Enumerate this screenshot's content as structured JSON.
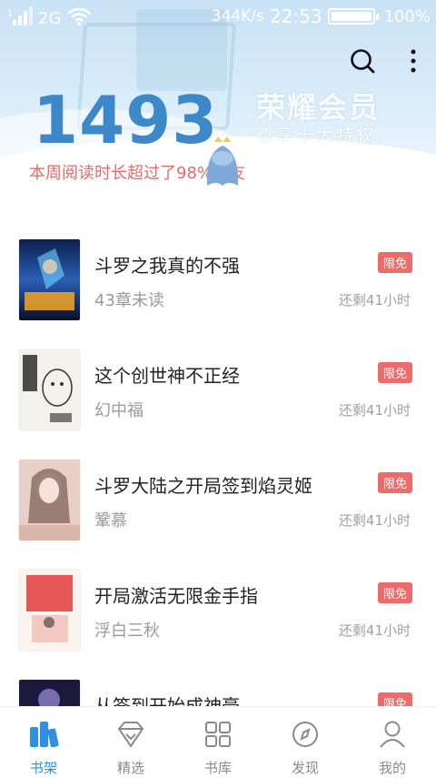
{
  "status_bar": {
    "network": "2G",
    "speed": "344K/s",
    "time": "22:53",
    "battery": "100%",
    "battery_level": 1.0
  },
  "header": {
    "reading_minutes": "1493",
    "reading_caption": "本周阅读时长超过了98%书友",
    "vip_title": "荣耀会员",
    "vip_subtitle": "尊享十大特权"
  },
  "books": [
    {
      "title": "斗罗之我真的不强",
      "meta": "43章未读",
      "badge": "限免",
      "time_left": "还剩41小时"
    },
    {
      "title": "这个创世神不正经",
      "meta": "幻中福",
      "badge": "限免",
      "time_left": "还剩41小时"
    },
    {
      "title": "斗罗大陆之开局签到焰灵姬",
      "meta": "鞏慕",
      "badge": "限免",
      "time_left": "还剩41小时"
    },
    {
      "title": "开局激活无限金手指",
      "meta": "浮白三秋",
      "badge": "限免",
      "time_left": "还剩41小时"
    },
    {
      "title": "从签到开始成神豪",
      "meta": "",
      "badge": "限免",
      "time_left": ""
    }
  ],
  "tabs": [
    {
      "label": "书架",
      "icon": "bookshelf-icon",
      "active": true
    },
    {
      "label": "精选",
      "icon": "diamond-icon",
      "active": false
    },
    {
      "label": "书库",
      "icon": "grid-icon",
      "active": false
    },
    {
      "label": "发现",
      "icon": "compass-icon",
      "active": false
    },
    {
      "label": "我的",
      "icon": "user-icon",
      "active": false
    }
  ],
  "colors": {
    "accent": "#2f8fe3",
    "badge": "#ee6b6b",
    "big_number": "#3d88c8",
    "caption": "#e06c6c"
  }
}
